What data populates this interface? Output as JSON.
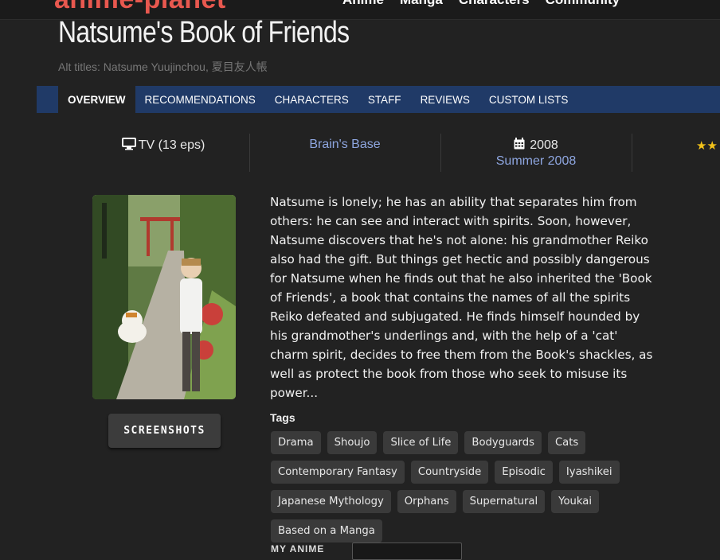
{
  "header": {
    "logo": "anime-planet",
    "nav": [
      "Anime",
      "Manga",
      "Characters",
      "Community"
    ]
  },
  "title": "Natsume's Book of Friends",
  "alt_titles": "Alt titles: Natsume Yuujinchou, 夏目友人帳",
  "tabs": [
    "OVERVIEW",
    "RECOMMENDATIONS",
    "CHARACTERS",
    "STAFF",
    "REVIEWS",
    "CUSTOM LISTS"
  ],
  "info": {
    "type": "TV (13 eps)",
    "studio": "Brain's Base",
    "year": "2008",
    "season": "Summer 2008",
    "rating_stars": "★★"
  },
  "screenshots_button": "SCREENSHOTS",
  "synopsis": "Natsume is lonely; he has an ability that separates him from others: he can see and interact with spirits. Soon, however, Natsume discovers that he's not alone: his grandmother Reiko also had the gift. But things get hectic and possibly dangerous for Natsume when he finds out that he also inherited the 'Book of Friends', a book that contains the names of all the spirits Reiko defeated and subjugated. He finds himself hounded by his grandmother's underlings and, with the help of a 'cat' charm spirit, decides to free them from the Book's shackles, as well as protect the book from those who seek to misuse its power...",
  "tags_label": "Tags",
  "tags": [
    "Drama",
    "Shoujo",
    "Slice of Life",
    "Bodyguards",
    "Cats",
    "Contemporary Fantasy",
    "Countryside",
    "Episodic",
    "Iyashikei",
    "Japanese Mythology",
    "Orphans",
    "Supernatural",
    "Youkai",
    "Based on a Manga"
  ],
  "my_anime_label": "MY ANIME",
  "colors": {
    "tab_bar": "#203a67",
    "link": "#8ea6e0",
    "logo": "#e8584f"
  }
}
